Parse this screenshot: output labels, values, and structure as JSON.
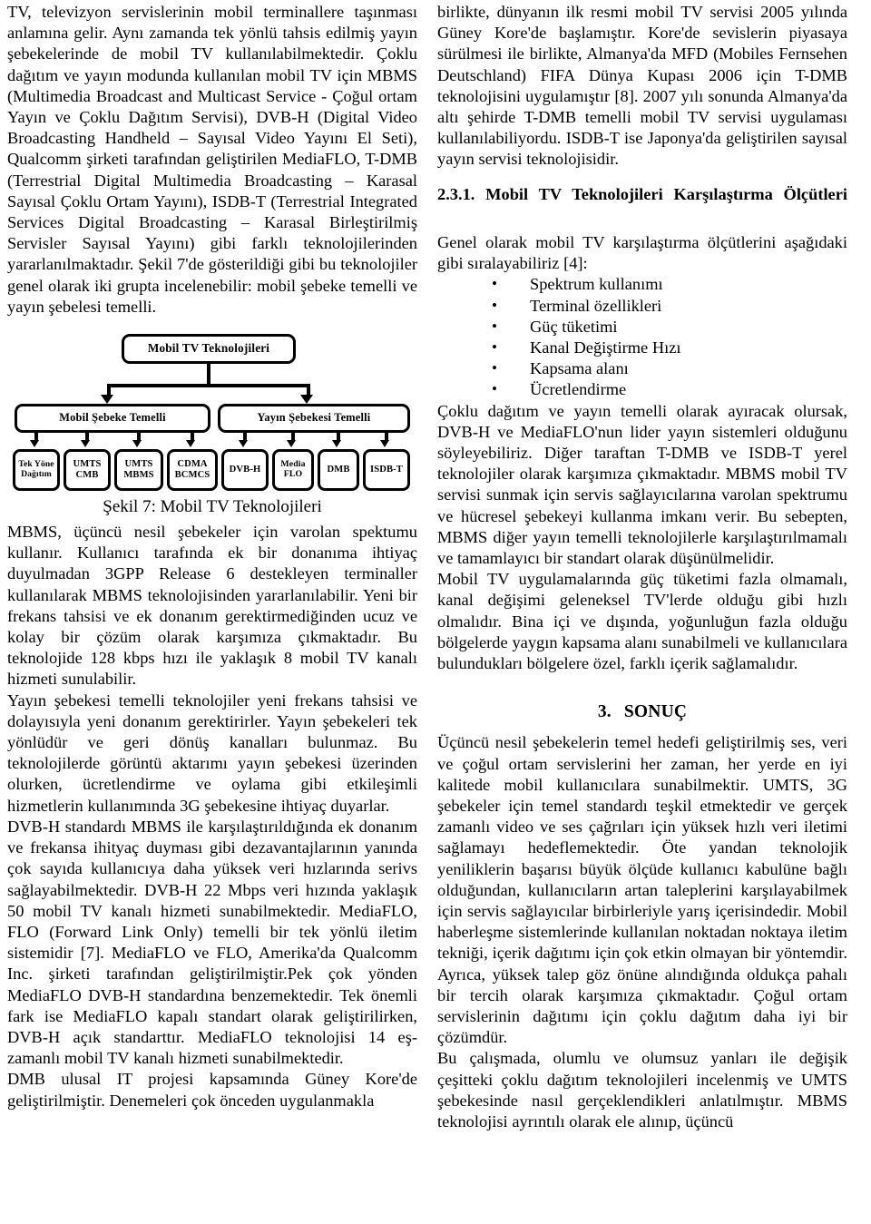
{
  "document": {
    "type": "academic-paper-page",
    "language": "tr",
    "columns": 2
  },
  "left_column": {
    "paragraphs": [
      "TV, televizyon servislerinin mobil terminallere taşınması anlamına gelir. Aynı zamanda tek yönlü tahsis edilmiş yayın şebekelerinde de mobil TV kullanılabilmektedir. Çoklu dağıtım ve yayın modunda kullanılan mobil TV için MBMS (Multimedia Broadcast and Multicast Service - Çoğul ortam Yayın ve Çoklu Dağıtım Servisi), DVB-H (Digital Video Broadcasting Handheld – Sayısal Video Yayını El Seti), Qualcomm şirketi tarafından geliştirilen MediaFLO, T-DMB (Terrestrial Digital Multimedia Broadcasting – Karasal Sayısal Çoklu Ortam Yayını), ISDB-T (Terrestrial Integrated Services Digital Broadcasting – Karasal Birleştirilmiş Servisler Sayısal Yayını) gibi farklı teknolojilerinden yararlanılmaktadır. Şekil 7'de gösterildiği gibi bu teknolojiler genel olarak iki grupta incelenebilir: mobil şebeke temelli ve yayın şebelesi temelli."
    ],
    "paragraphs_after_figure": [
      "MBMS, üçüncü nesil şebekeler için varolan spektumu kullanır. Kullanıcı tarafında ek bir donanıma ihtiyaç duyulmadan 3GPP Release 6 destekleyen terminaller kullanılarak MBMS teknolojisinden yararlanılabilir. Yeni bir frekans tahsisi ve ek donanım gerektirmediğinden ucuz ve kolay bir çözüm olarak karşımıza çıkmaktadır. Bu teknolojide 128 kbps hızı ile yaklaşık 8 mobil TV kanalı hizmeti sunulabilir.",
      "Yayın şebekesi temelli teknolojiler yeni frekans tahsisi ve dolayısıyla yeni donanım gerektirirler. Yayın şebekeleri tek yönlüdür ve geri dönüş kanalları bulunmaz. Bu teknolojilerde görüntü aktarımı yayın şebekesi üzerinden olurken, ücretlendirme ve oylama gibi etkileşimli hizmetlerin kullanımında 3G şebekesine ihtiyaç duyarlar.",
      "DVB-H standardı MBMS ile karşılaştırıldığında ek donanım ve frekansa ihityaç duyması gibi dezavantajlarının yanında çok sayıda kullanıcıya daha yüksek veri hızlarında serivs sağlayabilmektedir. DVB-H 22 Mbps veri hızında yaklaşık 50 mobil  TV kanalı hizmeti sunabilmektedir. MediaFLO, FLO (Forward Link Only) temelli bir tek yönlü iletim sistemidir [7]. MediaFLO ve FLO, Amerika'da Qualcomm Inc. şirketi tarafından geliştirilmiştir.Pek çok yönden MediaFLO DVB-H standardına benzemektedir. Tek önemli fark ise MediaFLO kapalı standart olarak geliştirilirken, DVB-H açık standarttır. MediaFLO teknolojisi 14 eş-zamanlı mobil TV kanalı hizmeti sunabilmektedir.",
      "DMB ulusal IT projesi kapsamında Güney Kore'de geliştirilmiştir. Denemeleri çok önceden uygulanmakla"
    ]
  },
  "figure": {
    "caption": "Şekil 7: Mobil TV Teknolojileri",
    "root": "Mobil TV Teknolojileri",
    "branches": [
      {
        "label": "Mobil Şebeke Temelli",
        "leaves": [
          "Tek Yöne Dağıtım",
          "UMTS CMB",
          "UMTS MBMS",
          "CDMA BCMCS"
        ]
      },
      {
        "label": "Yayın Şebekesi Temelli",
        "leaves": [
          "DVB-H",
          "Media FLO",
          "DMB",
          "ISDB-T"
        ]
      }
    ],
    "leaves_flat": [
      "Tek Yöne Dağıtım",
      "UMTS CMB",
      "UMTS MBMS",
      "CDMA BCMCS",
      "DVB-H",
      "Media FLO",
      "DMB",
      "ISDB-T"
    ]
  },
  "right_column": {
    "paragraph_top": "birlikte, dünyanın ilk resmi mobil TV servisi 2005 yılında Güney Kore'de başlamıştır. Kore'de sevislerin piyasaya sürülmesi ile birlikte, Almanya'da MFD (Mobiles Fernsehen Deutschland) FIFA Dünya Kupası 2006 için T-DMB teknolojisini uygulamıştır [8]. 2007 yılı sonunda Almanya'da altı şehirde T-DMB temelli mobil TV servisi uygulaması kullanılabiliyordu. ISDB-T ise Japonya'da geliştirilen sayısal yayın servisi teknolojisidir.",
    "section": {
      "number": "2.3.1.",
      "title": "Mobil TV Teknolojileri Karşılaştırma Ölçütleri",
      "full": "2.3.1. Mobil TV Teknolojileri Karşılaştırma Ölçütleri"
    },
    "intro": "Genel olarak mobil TV karşılaştırma ölçütlerini aşağıdaki gibi sıralayabiliriz [4]:",
    "criteria": [
      "Spektrum kullanımı",
      "Terminal özellikleri",
      "Güç tüketimi",
      "Kanal Değiştirme Hızı",
      "Kapsama alanı",
      "Ücretlendirme"
    ],
    "paragraphs": [
      "Çoklu dağıtım ve yayın temelli olarak ayıracak olursak, DVB-H ve MediaFLO'nun lider yayın sistemleri olduğunu söyleyebiliriz. Diğer taraftan T-DMB ve ISDB-T yerel teknolojiler olarak karşımıza çıkmaktadır. MBMS mobil TV servisi sunmak için servis sağlayıcılarına varolan spektrumu ve hücresel şebekeyi kullanma imkanı verir. Bu sebepten, MBMS diğer yayın temelli teknolojilerle karşılaştırılmamalı ve tamamlayıcı bir standart olarak düşünülmelidir.",
      "Mobil TV uygulamalarında güç tüketimi fazla olmamalı, kanal değişimi geleneksel TV'lerde olduğu gibi hızlı olmalıdır. Bina içi ve dışında, yoğunluğun fazla olduğu bölgelerde yaygın kapsama alanı sunabilmeli ve kullanıcılara bulundukları bölgelere özel, farklı içerik sağlamalıdır."
    ],
    "conclusion": {
      "number": "3.",
      "title": "SONUÇ",
      "paragraphs": [
        "Üçüncü nesil şebekelerin temel hedefi geliştirilmiş ses, veri ve çoğul ortam servislerini her zaman, her yerde en iyi kalitede mobil kullanıcılara sunabilmektir. UMTS, 3G şebekeler için temel standardı teşkil etmektedir ve gerçek zamanlı video ve ses çağrıları için yüksek hızlı veri iletimi sağlamayı hedeflemektedir. Öte yandan teknolojik yeniliklerin başarısı büyük ölçüde kullanıcı kabulüne bağlı olduğundan, kullanıcıların artan taleplerini karşılayabilmek için servis sağlayıcılar birbirleriyle yarış içerisindedir. Mobil haberleşme sistemlerinde kullanılan noktadan noktaya iletim tekniği, içerik dağıtımı için çok etkin olmayan bir yöntemdir. Ayrıca, yüksek talep göz önüne alındığında oldukça pahalı bir tercih olarak karşımıza çıkmaktadır. Çoğul ortam servislerinin dağıtımı için çoklu dağıtım daha iyi bir çözümdür.",
        "Bu çalışmada, olumlu ve olumsuz yanları ile değişik çeşitteki çoklu dağıtım teknolojileri incelenmiş ve UMTS şebekesinde nasıl gerçeklendikleri anlatılmıştır. MBMS teknolojisi ayrıntılı olarak ele alınıp, üçüncü"
      ]
    }
  }
}
